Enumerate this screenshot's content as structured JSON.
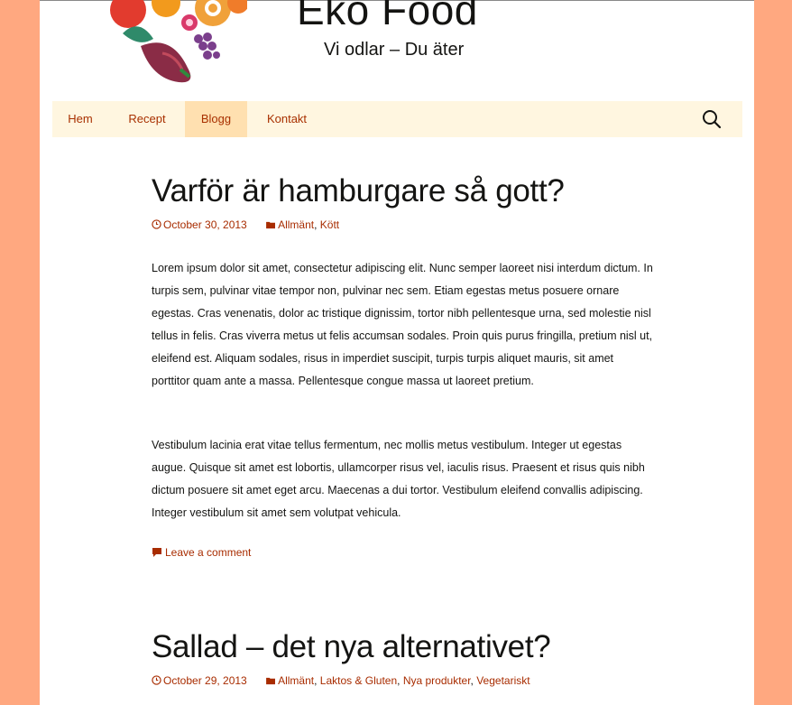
{
  "site": {
    "title": "Eko Food",
    "tagline": "Vi odlar – Du äter"
  },
  "nav": {
    "items": [
      {
        "label": "Hem"
      },
      {
        "label": "Recept"
      },
      {
        "label": "Blogg"
      },
      {
        "label": "Kontakt"
      }
    ],
    "active": "Blogg"
  },
  "colors": {
    "background": "#ffa880",
    "nav_bg": "#fff6e0",
    "nav_active_bg": "#ffe0b0",
    "link": "#a82c00"
  },
  "posts": [
    {
      "title": "Varför är hamburgare så gott?",
      "date": "October 30, 2013",
      "categories": [
        "Allmänt",
        "Kött"
      ],
      "paragraphs": [
        "Lorem ipsum dolor sit amet, consectetur adipiscing elit. Nunc semper laoreet nisi interdum dictum. In turpis sem, pulvinar vitae tempor non, pulvinar nec sem. Etiam egestas metus posuere ornare egestas. Cras venenatis, dolor ac tristique dignissim, tortor nibh pellentesque urna, sed molestie nisl tellus in felis. Cras viverra metus ut felis accumsan sodales. Proin quis purus fringilla, pretium nisl ut, eleifend est. Aliquam sodales, risus in imperdiet suscipit, turpis turpis aliquet mauris, sit amet porttitor quam ante a massa. Pellentesque congue massa ut laoreet pretium.",
        "Vestibulum lacinia erat vitae tellus fermentum, nec mollis metus vestibulum. Integer ut egestas augue. Quisque sit amet est lobortis, ullamcorper risus vel, iaculis risus. Praesent et risus quis nibh dictum posuere sit amet eget arcu. Maecenas a dui tortor. Vestibulum eleifend convallis adipiscing. Integer vestibulum sit amet sem volutpat vehicula."
      ],
      "comment_link": "Leave a comment"
    },
    {
      "title": "Sallad – det nya alternativet?",
      "date": "October 29, 2013",
      "categories": [
        "Allmänt",
        "Laktos & Gluten",
        "Nya produkter",
        "Vegetariskt"
      ]
    }
  ]
}
